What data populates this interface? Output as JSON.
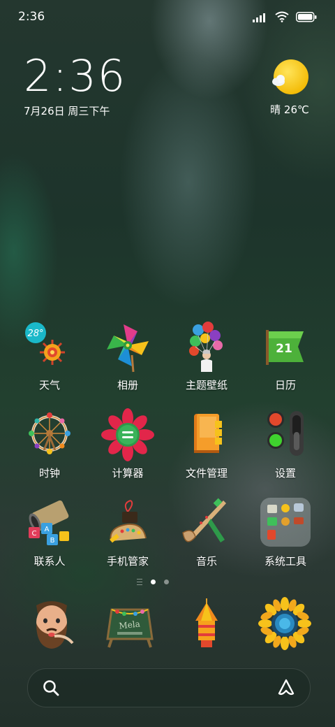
{
  "status_bar": {
    "time": "2:36",
    "icons": [
      "signal-icon",
      "wifi-icon",
      "battery-icon"
    ]
  },
  "clock_widget": {
    "time": "2:36",
    "date": "7月26日 周三下午"
  },
  "weather_widget": {
    "condition": "晴",
    "temperature": "26℃",
    "text": "晴 26℃",
    "icon": "sunny-cloud-icon"
  },
  "apps": [
    {
      "label": "天气",
      "icon": "weather-icon",
      "badge": "28°"
    },
    {
      "label": "相册",
      "icon": "pinwheel-icon"
    },
    {
      "label": "主题壁纸",
      "icon": "balloons-icon"
    },
    {
      "label": "日历",
      "icon": "calendar-flag-icon",
      "day": "21"
    },
    {
      "label": "时钟",
      "icon": "ferris-wheel-icon"
    },
    {
      "label": "计算器",
      "icon": "flower-calculator-icon"
    },
    {
      "label": "文件管理",
      "icon": "folder-icon"
    },
    {
      "label": "设置",
      "icon": "traffic-light-icon"
    },
    {
      "label": "联系人",
      "icon": "pipe-blocks-icon"
    },
    {
      "label": "手机管家",
      "icon": "horn-cup-icon"
    },
    {
      "label": "音乐",
      "icon": "trumpet-icon"
    },
    {
      "label": "系统工具",
      "icon": "folder-tools-icon"
    }
  ],
  "page_indicator": {
    "pages": 2,
    "current": 1
  },
  "dock": [
    {
      "icon": "bearded-man-icon"
    },
    {
      "icon": "sign-board-icon",
      "text": "Mela"
    },
    {
      "icon": "lantern-icon"
    },
    {
      "icon": "sunflower-icon"
    }
  ],
  "search_bar": {
    "search_icon": "search-icon",
    "assistant_icon": "assistant-icon"
  },
  "colors": {
    "sun_yellow": "#f7c600",
    "calendar_green": "#4db13a",
    "weather_badge": "#1ab8c9"
  }
}
